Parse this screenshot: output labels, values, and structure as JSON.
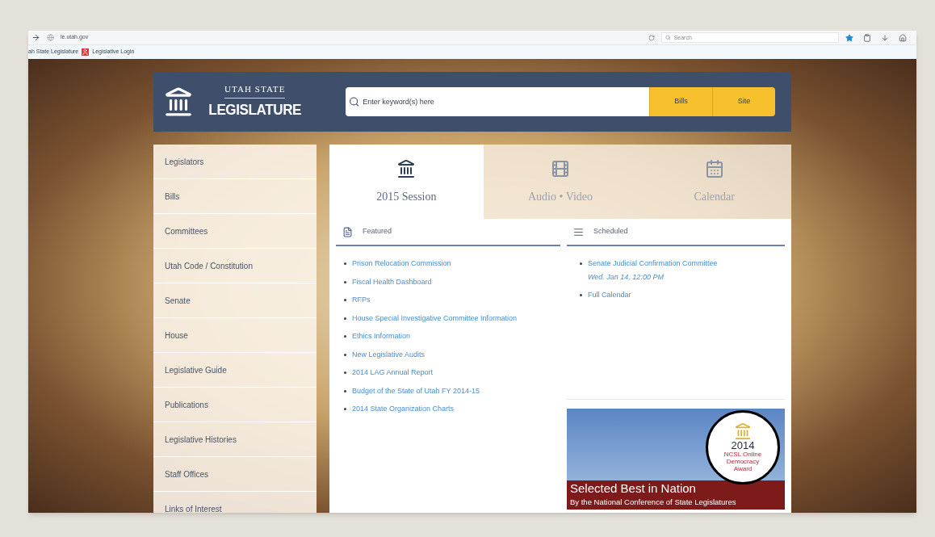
{
  "browser": {
    "address": "le.utah.gov",
    "search_placeholder": "Search",
    "bookmarks": [
      {
        "label": "ah State Legislature",
        "kind": "plain"
      },
      {
        "label": "Legislative Login",
        "kind": "icon"
      }
    ]
  },
  "header": {
    "logo_top": "UTAH STATE",
    "logo_bottom": "LEGISLATURE",
    "search_placeholder": "Enter keyword(s) here",
    "buttons": [
      "Bills",
      "Site"
    ]
  },
  "sidebar": {
    "items": [
      "Legislators",
      "Bills",
      "Committees",
      "Utah Code / Constitution",
      "Senate",
      "House",
      "Legislative Guide",
      "Publications",
      "Legislative Histories",
      "Staff Offices",
      "Links of Interest"
    ]
  },
  "tabs": [
    {
      "label": "2015 Session",
      "kind": "capitol",
      "selected": true
    },
    {
      "label": "Audio • Video",
      "kind": "film",
      "selected": false
    },
    {
      "label": "Calendar",
      "kind": "calendar",
      "selected": false
    }
  ],
  "featured": {
    "title": "Featured",
    "links": [
      "Prison Relocation Commission",
      "Fiscal Health Dashboard",
      "RFPs",
      "House Special Investigative Committee Information",
      "Ethics Information",
      "New Legislative Audits",
      "2014 LAG Annual Report",
      "Budget of the State of Utah FY 2014-15",
      "2014 State Organization Charts"
    ]
  },
  "scheduled": {
    "title": "Scheduled",
    "items": [
      {
        "label": "Senate Judicial Confirmation Committee",
        "when": "Wed. Jan 14, 12:00 PM"
      },
      {
        "label": "Full Calendar"
      }
    ]
  },
  "banner": {
    "award_year": "2014",
    "award_text": "NCSL Online Democracy Award",
    "headline": "Selected Best in Nation",
    "subline": "By the National Conference of State Legislatures"
  }
}
